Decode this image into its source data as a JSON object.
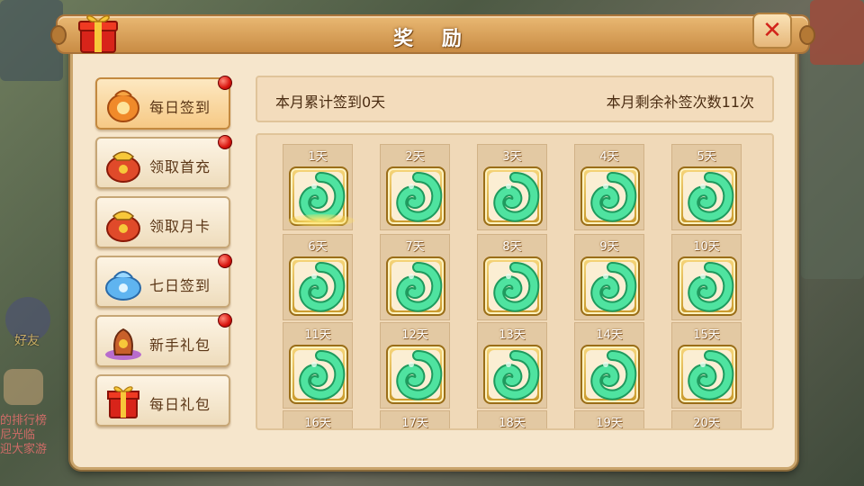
{
  "window": {
    "title": "奖 励"
  },
  "sidebar": {
    "items": [
      {
        "label": "每日签到",
        "icon": "sign-in-pouch-icon",
        "badge": true,
        "active": true
      },
      {
        "label": "领取首充",
        "icon": "first-recharge-bag-icon",
        "badge": true,
        "active": false
      },
      {
        "label": "领取月卡",
        "icon": "monthly-card-bag-icon",
        "badge": false,
        "active": false
      },
      {
        "label": "七日签到",
        "icon": "seven-day-bag-icon",
        "badge": true,
        "active": false
      },
      {
        "label": "新手礼包",
        "icon": "newbie-gift-icon",
        "badge": true,
        "active": false
      },
      {
        "label": "每日礼包",
        "icon": "daily-gift-box-icon",
        "badge": false,
        "active": false
      }
    ]
  },
  "summary": {
    "cumulative": "本月累计签到0天",
    "remaining": "本月剩余补签次数11次"
  },
  "days": [
    "1天",
    "2天",
    "3天",
    "4天",
    "5天",
    "6天",
    "7天",
    "8天",
    "9天",
    "10天",
    "11天",
    "12天",
    "13天",
    "14天",
    "15天",
    "16天",
    "17天",
    "18天",
    "19天",
    "20天"
  ],
  "reward_icon": "jade-reward-icon",
  "background": {
    "labels": [
      "好友"
    ],
    "chat": [
      "的排行榜",
      "尼光临",
      "迎大家游"
    ]
  },
  "colors": {
    "accent": "#d2241b",
    "jade": "#3fcf8a"
  }
}
